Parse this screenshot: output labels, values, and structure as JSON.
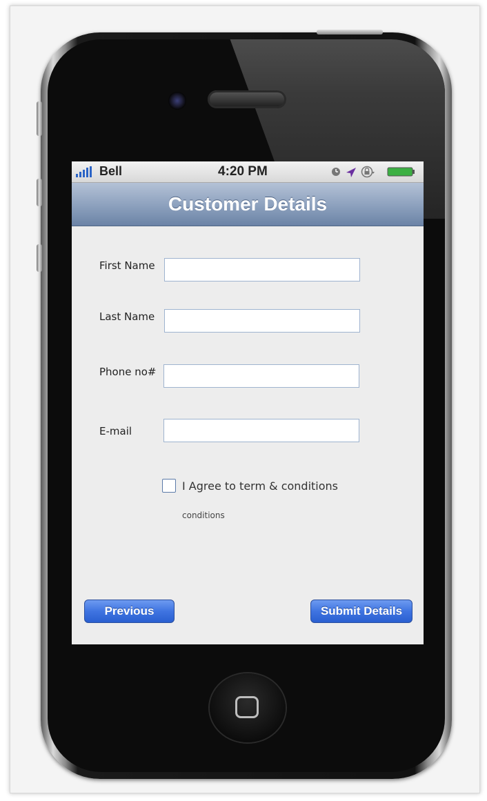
{
  "status_bar": {
    "carrier": "Bell",
    "time": "4:20 PM",
    "icons": [
      "clock-icon",
      "location-arrow-icon",
      "orientation-lock-icon",
      "battery-icon"
    ]
  },
  "nav": {
    "title": "Customer Details"
  },
  "form": {
    "first_name_label": "First Name",
    "first_name_value": "",
    "last_name_label": "Last Name",
    "last_name_value": "",
    "phone_label": "Phone no#",
    "phone_value": "",
    "email_label": "E-mail",
    "email_value": "",
    "agree_label": "I Agree to term & conditions",
    "agree_sublabel": "conditions",
    "agree_checked": false
  },
  "buttons": {
    "previous_label": "Previous",
    "submit_label": "Submit Details"
  },
  "colors": {
    "accent": "#3f74e1",
    "nav_bar": "#8fa3bf",
    "screen_bg": "#ededed"
  }
}
